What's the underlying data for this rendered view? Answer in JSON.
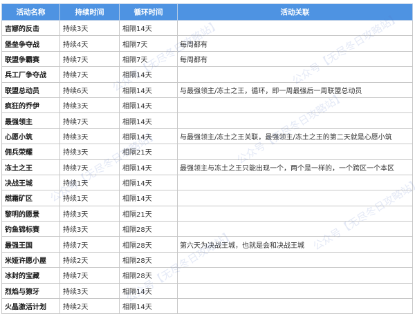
{
  "headers": [
    "活动名称",
    "持续时间",
    "循环时间",
    "活动关联"
  ],
  "rows": [
    {
      "name": "吉娜的反击",
      "duration": "持续3天",
      "cycle": "相隔14天",
      "relation": ""
    },
    {
      "name": "堡垒争夺战",
      "duration": "持续4天",
      "cycle": "相隔7天",
      "relation": "每周都有"
    },
    {
      "name": "联盟争霸赛",
      "duration": "持续7天",
      "cycle": "相隔7天",
      "relation": "每周都有"
    },
    {
      "name": "兵工厂争夺战",
      "duration": "持续7天",
      "cycle": "相隔14天",
      "relation": ""
    },
    {
      "name": "联盟总动员",
      "duration": "持续6天",
      "cycle": "相隔14天",
      "relation": "与最强领主/冻土之王，循环，即一周最强后一周联盟总动员"
    },
    {
      "name": "疯狂的乔伊",
      "duration": "持续3天",
      "cycle": "相隔14天",
      "relation": ""
    },
    {
      "name": "最强领主",
      "duration": "持续7天",
      "cycle": "相隔14天",
      "relation": ""
    },
    {
      "name": "心愿小筑",
      "duration": "持续3天",
      "cycle": "相隔14天",
      "relation": "与最强领主/冻土之王关联，最强领主/冻土之王的第二天就是心愿小筑"
    },
    {
      "name": "佣兵荣耀",
      "duration": "持续3天",
      "cycle": "相隔21天",
      "relation": ""
    },
    {
      "name": "冻土之王",
      "duration": "持续7天",
      "cycle": "相隔14天",
      "relation": "最强领主与冻土之王只能出现一个，两个是一样的，一个跨区一个本区"
    },
    {
      "name": "决战王城",
      "duration": "持续1天",
      "cycle": "相隔14天",
      "relation": ""
    },
    {
      "name": "燃霜矿区",
      "duration": "持续1天",
      "cycle": "相隔14天",
      "relation": ""
    },
    {
      "name": "黎明的愿景",
      "duration": "持续3天",
      "cycle": "相隔21天",
      "relation": ""
    },
    {
      "name": "钓鱼锦标赛",
      "duration": "持续3天",
      "cycle": "相隔28天",
      "relation": ""
    },
    {
      "name": "最强王国",
      "duration": "持续7天",
      "cycle": "相隔28天",
      "relation": "第六天为决战王城，也就是会和决战王城"
    },
    {
      "name": "米娅许愿小屋",
      "duration": "持续2天",
      "cycle": "相隔28天",
      "relation": ""
    },
    {
      "name": "冰封的宝藏",
      "duration": "持续7天",
      "cycle": "相隔28天",
      "relation": ""
    },
    {
      "name": "烈焰与獠牙",
      "duration": "持续3天",
      "cycle": "相隔14天",
      "relation": ""
    },
    {
      "name": "火晶激活计划",
      "duration": "持续2天",
      "cycle": "相隔14天",
      "relation": ""
    }
  ],
  "watermark": "公众号【无尽冬日攻略站】",
  "colors": {
    "header_bg": "#4e93e2",
    "header_text": "#ffffff",
    "grid": "#c6c6c6"
  }
}
